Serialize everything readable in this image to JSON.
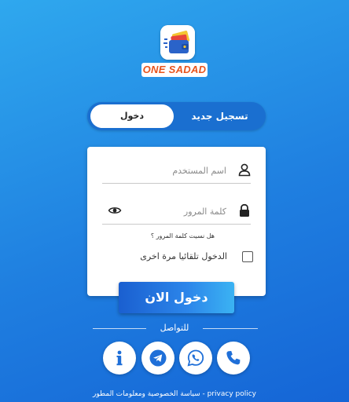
{
  "brand": {
    "name": "ONE SADAD"
  },
  "tabs": {
    "register_label": "تسجيل جديد",
    "login_label": "دخول",
    "active": "login"
  },
  "form": {
    "username_placeholder": "اسم المستخدم",
    "password_placeholder": "كلمة المرور",
    "forgot_password": "هل نسيت كلمة المرور ؟",
    "remember_label": "الدخول تلقائيا مرة اخرى",
    "remember_checked": false,
    "submit_label": "دخول الان"
  },
  "contact": {
    "label": "للتواصل",
    "buttons": [
      "info-icon",
      "telegram-icon",
      "whatsapp-icon",
      "phone-icon"
    ]
  },
  "footer": {
    "text": "سياسة الخصوصية ومعلومات المطور - privacy policy"
  },
  "colors": {
    "accent": "#1f7fe0",
    "brand_orange": "#e8541d",
    "white": "#ffffff"
  }
}
